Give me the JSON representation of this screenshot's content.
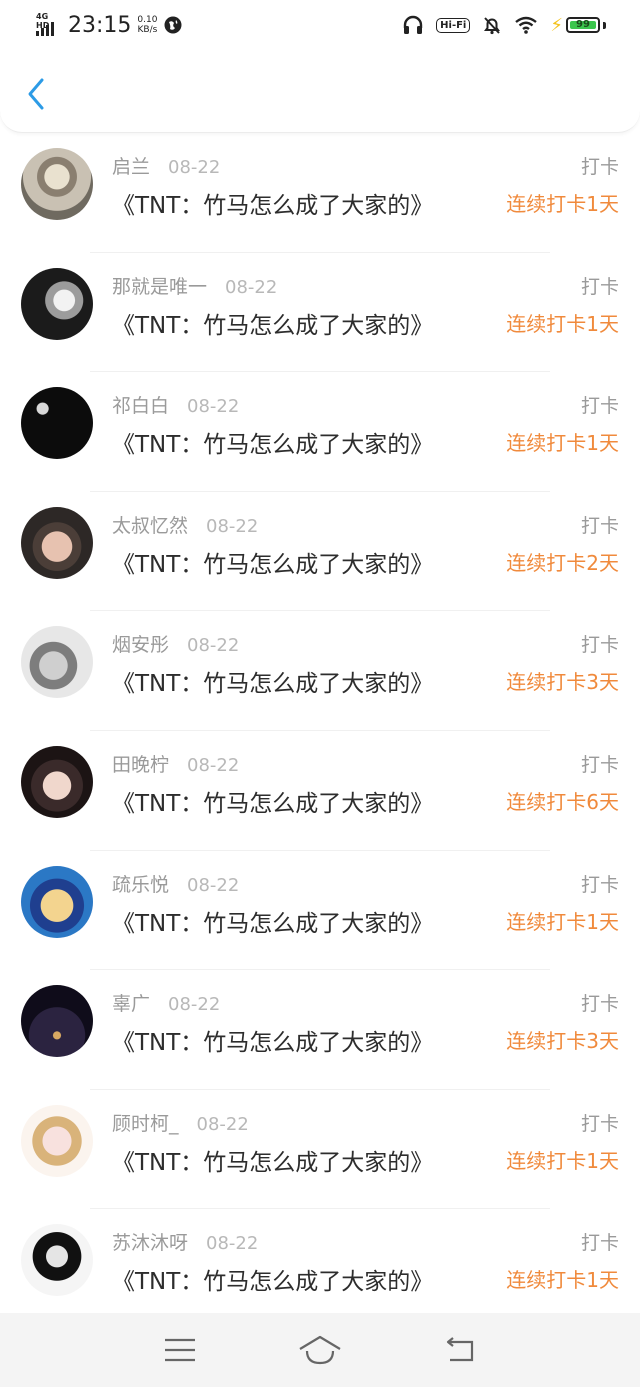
{
  "status_bar": {
    "network": "4G HD",
    "time": "23:15",
    "speed_value": "0.10",
    "speed_unit": "KB/s",
    "wifi_badge": "Hi-Fi",
    "battery": "99",
    "battery_level": 0.99,
    "battery_color": "#3bc64c"
  },
  "header": {
    "back_icon": "chevron-left-icon",
    "accent": "#2c9be6"
  },
  "records": [
    {
      "name": "启兰",
      "date": "08-22",
      "title": "《TNT：竹马怎么成了大家的》",
      "type": "打卡",
      "streak": "连续打卡1天"
    },
    {
      "name": "那就是唯一",
      "date": "08-22",
      "title": "《TNT：竹马怎么成了大家的》",
      "type": "打卡",
      "streak": "连续打卡1天"
    },
    {
      "name": "祁白白",
      "date": "08-22",
      "title": "《TNT：竹马怎么成了大家的》",
      "type": "打卡",
      "streak": "连续打卡1天"
    },
    {
      "name": "太叔忆然",
      "date": "08-22",
      "title": "《TNT：竹马怎么成了大家的》",
      "type": "打卡",
      "streak": "连续打卡2天"
    },
    {
      "name": "烟安彤",
      "date": "08-22",
      "title": "《TNT：竹马怎么成了大家的》",
      "type": "打卡",
      "streak": "连续打卡3天"
    },
    {
      "name": "田晚柠",
      "date": "08-22",
      "title": "《TNT：竹马怎么成了大家的》",
      "type": "打卡",
      "streak": "连续打卡6天"
    },
    {
      "name": "疏乐悦",
      "date": "08-22",
      "title": "《TNT：竹马怎么成了大家的》",
      "type": "打卡",
      "streak": "连续打卡1天"
    },
    {
      "name": "辜广",
      "date": "08-22",
      "title": "《TNT：竹马怎么成了大家的》",
      "type": "打卡",
      "streak": "连续打卡3天"
    },
    {
      "name": "顾时柯_",
      "date": "08-22",
      "title": "《TNT：竹马怎么成了大家的》",
      "type": "打卡",
      "streak": "连续打卡1天"
    },
    {
      "name": "苏沐沐呀",
      "date": "08-22",
      "title": "《TNT：竹马怎么成了大家的》",
      "type": "打卡",
      "streak": "连续打卡1天"
    }
  ],
  "colors": {
    "streak": "#f08a3c",
    "muted": "#9a9a9a"
  },
  "nav": {
    "menu_icon": "menu-icon",
    "home_icon": "home-icon",
    "back_icon": "back-arrow-icon"
  }
}
